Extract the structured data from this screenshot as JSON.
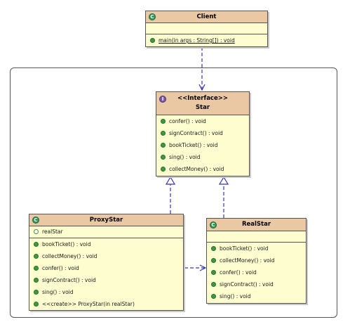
{
  "client": {
    "name": "Client",
    "icon": "class-icon",
    "operations": [
      {
        "label": "main(in args : String[]) : void",
        "static": true
      }
    ]
  },
  "star": {
    "stereotype": "<<Interface>>",
    "name": "Star",
    "icon": "interface-icon",
    "operations": [
      {
        "label": "confer() : void"
      },
      {
        "label": "signContract() : void"
      },
      {
        "label": "bookTicket() : void"
      },
      {
        "label": "sing() : void"
      },
      {
        "label": "collectMoney() : void"
      }
    ]
  },
  "proxystar": {
    "name": "ProxyStar",
    "icon": "class-icon",
    "attributes": [
      {
        "label": "realStar"
      }
    ],
    "operations": [
      {
        "label": "bookTicket() : void"
      },
      {
        "label": "collectMoney() : void"
      },
      {
        "label": "confer() : void"
      },
      {
        "label": "signContract() : void"
      },
      {
        "label": "sing() : void"
      },
      {
        "label": "<<create>> ProxyStar(in realStar)"
      }
    ]
  },
  "realstar": {
    "name": "RealStar",
    "icon": "class-icon",
    "operations": [
      {
        "label": "bookTicket() : void"
      },
      {
        "label": "collectMoney() : void"
      },
      {
        "label": "confer() : void"
      },
      {
        "label": "signContract() : void"
      },
      {
        "label": "sing() : void"
      }
    ]
  },
  "colors": {
    "header": "#ebc8a4",
    "body": "#fdfdd0",
    "border": "#555555",
    "connector": "#3535b8",
    "method_dot": "#3e9a3e"
  }
}
